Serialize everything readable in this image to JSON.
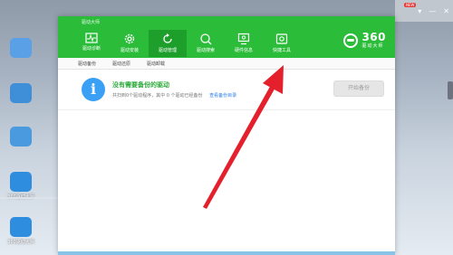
{
  "app": {
    "title": "驱动大师",
    "nav": [
      {
        "label": "驱动诊断",
        "icon": "pulse-icon"
      },
      {
        "label": "驱动安装",
        "icon": "gear-icon"
      },
      {
        "label": "驱动管理",
        "icon": "refresh-icon",
        "active": true
      },
      {
        "label": "驱动搜索",
        "icon": "search-icon"
      },
      {
        "label": "硬件信息",
        "icon": "monitor-icon"
      },
      {
        "label": "快捷工具",
        "icon": "toolbox-icon"
      }
    ],
    "brand": {
      "number": "360",
      "name": "驱动大师"
    }
  },
  "sub_tabs": [
    "驱动备份",
    "驱动还原",
    "驱动卸载"
  ],
  "panel": {
    "headline": "没有需要备份的驱动",
    "description": "共扫到0个驱动程序，其中 0 个驱动已经备份",
    "link": "查看备份目录",
    "button": "开始备份"
  },
  "desktop": {
    "icons": [
      {
        "label": ""
      },
      {
        "label": ""
      },
      {
        "label": ""
      },
      {
        "label": "360驱动大师"
      },
      {
        "label": "360驱动大师"
      }
    ],
    "badge": "NEW"
  },
  "colors": {
    "brand_green": "#2bbd3a",
    "active_green": "#1e9f2c",
    "info_blue": "#39a0f5",
    "arrow_red": "#e5202d"
  }
}
